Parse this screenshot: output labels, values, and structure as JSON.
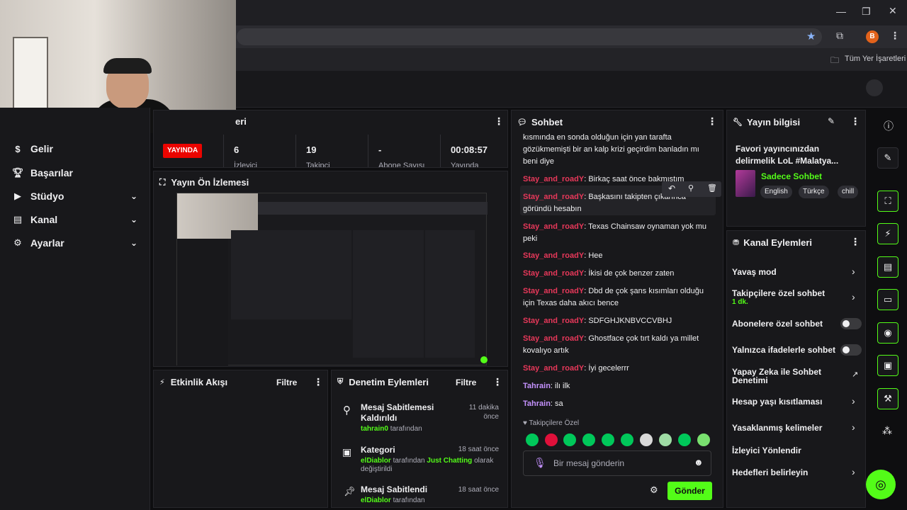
{
  "chrome": {
    "bookmarks_label": "Tüm Yer İşaretleri",
    "profile_initial": "B"
  },
  "nav": {
    "items": [
      {
        "label": "Gelir"
      },
      {
        "label": "Başarılar"
      },
      {
        "label": "Stüdyo"
      },
      {
        "label": "Kanal"
      },
      {
        "label": "Ayarlar"
      }
    ]
  },
  "stats": {
    "title_fragment": "eri",
    "live_badge": "YAYINDA",
    "viewers_value": "6",
    "viewers_label": "İzleyici",
    "followers_value": "19",
    "followers_label": "Takipçi",
    "subs_value": "-",
    "subs_label": "Abone Sayısı",
    "uptime_value": "00:08:57",
    "uptime_label": "Yayında"
  },
  "preview": {
    "title": "Yayın Ön İzlemesi"
  },
  "activity": {
    "title": "Etkinlik Akışı",
    "filter": "Filtre"
  },
  "moderation": {
    "title": "Denetim Eylemleri",
    "filter": "Filtre",
    "items": [
      {
        "title1": "Mesaj Sabitlemesi",
        "title2": "Kaldırıldı",
        "time1": "11 dakika",
        "time2": "önce",
        "by_user": "tahrain0",
        "by_text": "tarafından"
      },
      {
        "title1": "Kategori",
        "time1": "18 saat önce",
        "by_user": "elDiablor",
        "by_text": "tarafından",
        "category": "Just Chatting",
        "suffix": "olarak",
        "line2": "değiştirildi"
      },
      {
        "title1": "Mesaj Sabitlendi",
        "time1": "18 saat önce",
        "by_user": "elDiablor",
        "by_text": "tarafından"
      }
    ]
  },
  "chat": {
    "title": "Sohbet",
    "intro": "kısmında en sonda olduğun için yan tarafta gözükmemişti bir an kalp krizi geçirdim banladın mı beni diye",
    "messages": [
      {
        "user": "Stay_and_roadY",
        "text": "Birkaç saat önce bakmıştım"
      },
      {
        "user": "Stay_and_roadY",
        "text": "Başkasını takipten çıkarınca göründü hesabın"
      },
      {
        "user": "Stay_and_roadY",
        "text": "Texas Chainsaw oynaman yok mu peki"
      },
      {
        "user": "Stay_and_roadY",
        "text": "Hee"
      },
      {
        "user": "Stay_and_roadY",
        "text": "İkisi de çok benzer zaten"
      },
      {
        "user": "Stay_and_roadY",
        "text": "Dbd de çok şans kısımları olduğu için Texas daha akıcı bence"
      },
      {
        "user": "Stay_and_roadY",
        "text": "SDFGHJKNBVCCVBHJ"
      },
      {
        "user": "Stay_and_roadY",
        "text": "Ghostface çok tırt kaldı ya millet kovalıyo artık"
      },
      {
        "user": "Stay_and_roadY",
        "text": "İyi gecelerrr"
      },
      {
        "user": "Tahrain",
        "text": "ilı ilk"
      },
      {
        "user": "Tahrain",
        "text": "sa"
      }
    ],
    "followers_only": "Takipçilere Özel",
    "input_placeholder": "Bir mesaj gönderin",
    "send_label": "Gönder"
  },
  "stream_info": {
    "title": "Yayın bilgisi",
    "stream_title": "Favori yayıncınızdan delirmelik LoL #Malatya...",
    "category": "Sadece Sohbet",
    "tags": [
      "English",
      "Türkçe",
      "chill"
    ]
  },
  "channel_actions": {
    "title": "Kanal Eylemleri",
    "slow_mode": "Yavaş mod",
    "followers_chat": "Takipçilere özel sohbet",
    "followers_chat_value": "1 dk.",
    "sub_chat": "Abonelere özel sohbet",
    "emote_chat": "Yalnızca ifadelerle sohbet",
    "ai_mod1": "Yapay Zeka ile Sohbet",
    "ai_mod2": "Denetimi",
    "age_restrict": "Hesap yaşı kısıtlaması",
    "banned_words": "Yasaklanmış kelimeler",
    "viewer_redirect": "İzleyici Yönlendir",
    "goals": "Hedefleri belirleyin"
  },
  "colors": {
    "accent_green": "#53fc18",
    "live_red": "#eb0400",
    "username_red": "#e8385a",
    "username_purple": "#c592ff"
  }
}
